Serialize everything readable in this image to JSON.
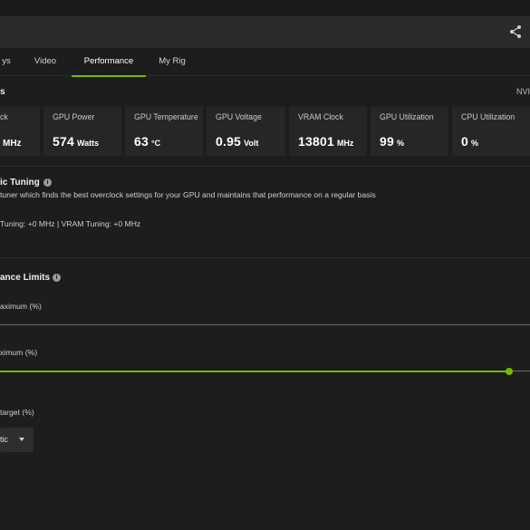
{
  "tabs": [
    {
      "label": "ys"
    },
    {
      "label": "Video"
    },
    {
      "label": "Performance"
    },
    {
      "label": "My Rig"
    }
  ],
  "active_tab": "Performance",
  "stats_section": {
    "title": "s",
    "right_label": "NVI"
  },
  "stats": [
    {
      "label": "ck",
      "value": "",
      "unit": "MHz"
    },
    {
      "label": "GPU Power",
      "value": "574",
      "unit": "Watts"
    },
    {
      "label": "GPU Temperature",
      "value": "63",
      "unit": "°C"
    },
    {
      "label": "GPU Voltage",
      "value": "0.95",
      "unit": "Volt"
    },
    {
      "label": "VRAM Clock",
      "value": "13801",
      "unit": "MHz"
    },
    {
      "label": "GPU Utilization",
      "value": "99",
      "unit": "%"
    },
    {
      "label": "CPU Utilization",
      "value": "0",
      "unit": "%"
    }
  ],
  "auto_tuning": {
    "title": "ic Tuning",
    "description": "tuner which finds the best overclock settings for your GPU and maintains that performance on a regular basis",
    "result": "Tuning: +0 MHz   |   VRAM Tuning: +0 MHz"
  },
  "limits": {
    "title": "ance Limits",
    "slider1_label": "aximum (%)",
    "slider1_fraction": 0,
    "slider2_label": "ximum (%)",
    "slider2_fraction": 0.96,
    "target_label": " target (%)",
    "dropdown_value": "tic"
  },
  "colors": {
    "accent": "#76b900",
    "background": "#1d1d1d",
    "card": "#262626"
  }
}
